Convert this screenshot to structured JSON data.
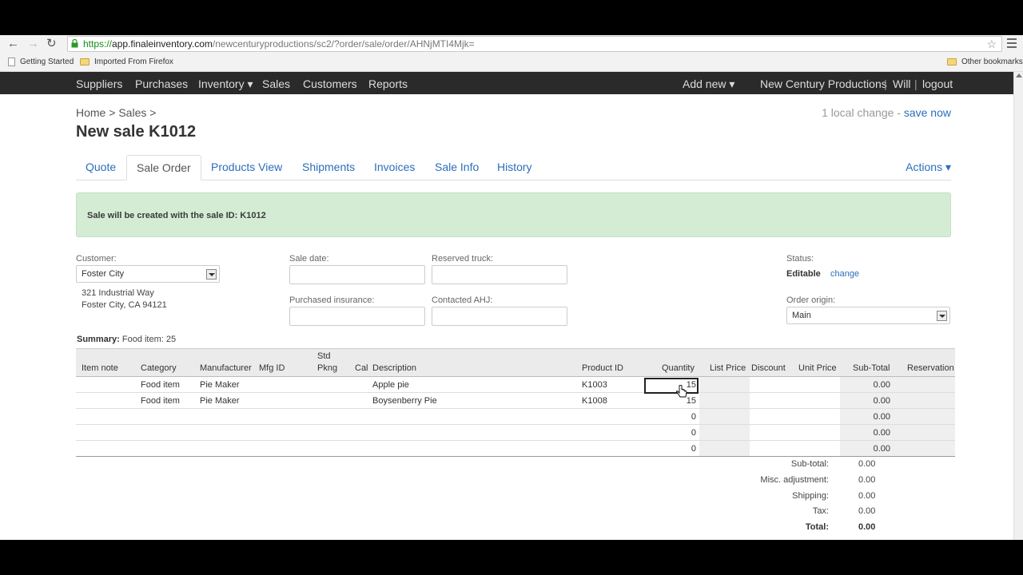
{
  "browser": {
    "url_secure": "https://",
    "url_host": "app.finaleinventory.com",
    "url_path": "/newcenturyproductions/sc2/?order/sale/order/AHNjMTI4Mjk=",
    "bookmarks": [
      "Getting Started",
      "Imported From Firefox"
    ],
    "other_bookmarks": "Other bookmarks"
  },
  "nav": {
    "left": [
      "Suppliers",
      "Purchases",
      "Inventory ▾",
      "Sales",
      "Customers",
      "Reports"
    ],
    "add_new": "Add new ▾",
    "company": "New Century Productions",
    "user": "Will",
    "logout": "logout",
    "sep": "|"
  },
  "breadcrumb": {
    "home": "Home",
    "sales": "Sales",
    "sep": ">"
  },
  "page": {
    "title": "New sale K1012",
    "local_change": "1 local change - ",
    "save_now": "save now"
  },
  "tabs": [
    "Quote",
    "Sale Order",
    "Products View",
    "Shipments",
    "Invoices",
    "Sale Info",
    "History"
  ],
  "actions": "Actions ▾",
  "alert": "Sale will be created with the sale ID: K1012",
  "form": {
    "customer_label": "Customer:",
    "customer_value": "Foster City",
    "address_1": "321 Industrial Way",
    "address_2": "Foster City, CA 94121",
    "sale_date_label": "Sale date:",
    "reserved_truck_label": "Reserved truck:",
    "purchased_insurance_label": "Purchased insurance:",
    "contacted_ahj_label": "Contacted AHJ:",
    "status_label": "Status:",
    "status_value": "Editable",
    "status_change": "change",
    "order_origin_label": "Order origin:",
    "order_origin_value": "Main"
  },
  "summary": {
    "label": "Summary:",
    "value": "Food item: 25"
  },
  "table": {
    "headers": {
      "item_note": "Item note",
      "category": "Category",
      "manufacturer": "Manufacturer",
      "mfg_id": "Mfg ID",
      "std_pkng_1": "Std",
      "std_pkng_2": "Pkng",
      "cal": "Cal",
      "description": "Description",
      "product_id": "Product ID",
      "quantity": "Quantity",
      "list_price": "List Price",
      "discount": "Discount",
      "unit_price": "Unit Price",
      "sub_total": "Sub-Total",
      "reservation": "Reservation"
    },
    "rows": [
      {
        "category": "Food item",
        "manufacturer": "Pie Maker",
        "description": "Apple pie",
        "product_id": "K1003",
        "quantity": "15",
        "sub_total": "0.00"
      },
      {
        "category": "Food item",
        "manufacturer": "Pie Maker",
        "description": "Boysenberry Pie",
        "product_id": "K1008",
        "quantity": "15",
        "sub_total": "0.00"
      },
      {
        "category": "",
        "manufacturer": "",
        "description": "",
        "product_id": "",
        "quantity": "0",
        "sub_total": "0.00"
      },
      {
        "category": "",
        "manufacturer": "",
        "description": "",
        "product_id": "",
        "quantity": "0",
        "sub_total": "0.00"
      },
      {
        "category": "",
        "manufacturer": "",
        "description": "",
        "product_id": "",
        "quantity": "0",
        "sub_total": "0.00"
      }
    ]
  },
  "totals": [
    {
      "label": "Sub-total:",
      "value": "0.00"
    },
    {
      "label": "Misc. adjustment:",
      "value": "0.00"
    },
    {
      "label": "Shipping:",
      "value": "0.00"
    },
    {
      "label": "Tax:",
      "value": "0.00"
    },
    {
      "label": "Total:",
      "value": "0.00"
    }
  ]
}
